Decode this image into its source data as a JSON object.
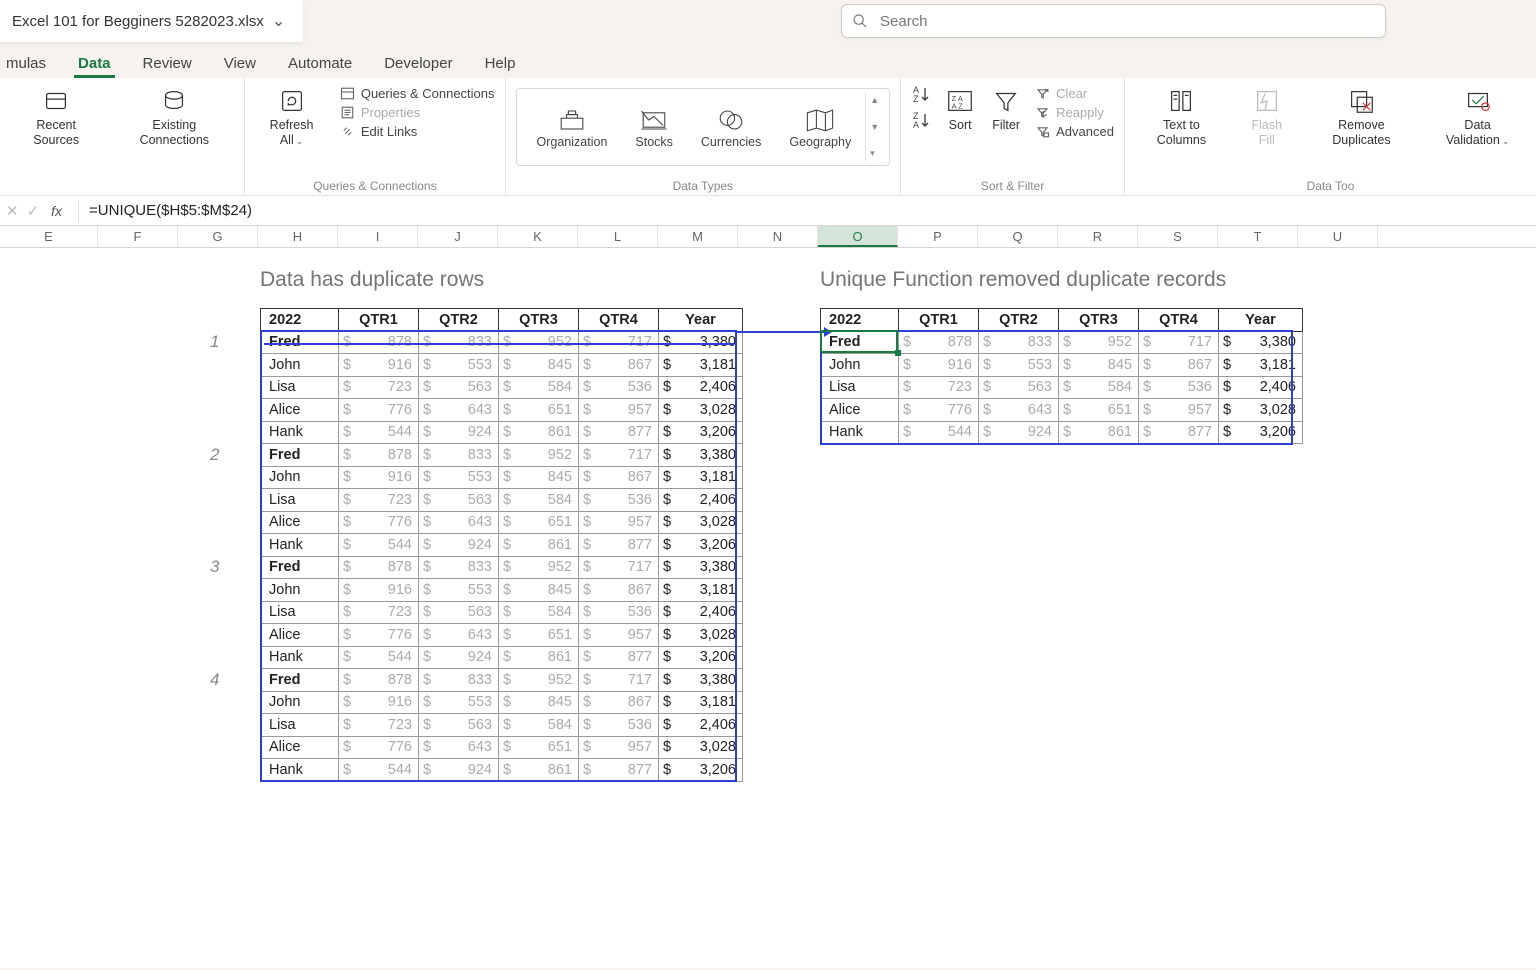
{
  "titlebar": {
    "filename": "Excel 101 for Begginers 5282023.xlsx",
    "search_placeholder": "Search"
  },
  "ribbon_tabs": [
    "mulas",
    "Data",
    "Review",
    "View",
    "Automate",
    "Developer",
    "Help"
  ],
  "active_tab": "Data",
  "ribbon": {
    "recent_sources": "Recent Sources",
    "existing_connections": "Existing Connections",
    "refresh_all": "Refresh All",
    "queries_connections": "Queries & Connections",
    "properties": "Properties",
    "edit_links": "Edit Links",
    "group_qc": "Queries & Connections",
    "organization": "Organization",
    "stocks": "Stocks",
    "currencies": "Currencies",
    "geography": "Geography",
    "group_dt": "Data Types",
    "sort": "Sort",
    "filter": "Filter",
    "clear": "Clear",
    "reapply": "Reapply",
    "advanced": "Advanced",
    "group_sf": "Sort & Filter",
    "text_to_columns": "Text to Columns",
    "flash_fill": "Flash Fill",
    "remove_duplicates": "Remove Duplicates",
    "data_validation": "Data Validation",
    "group_dtools": "Data Too"
  },
  "formula": "=UNIQUE($H$5:$M$24)",
  "columns": [
    "E",
    "F",
    "G",
    "H",
    "I",
    "J",
    "K",
    "L",
    "M",
    "N",
    "O",
    "P",
    "Q",
    "R",
    "S",
    "T",
    "U"
  ],
  "selected_col": "O",
  "titles": {
    "left": "Data has duplicate rows",
    "right": "Unique Function removed duplicate records"
  },
  "headers": [
    "2022",
    "QTR1",
    "QTR2",
    "QTR3",
    "QTR4",
    "Year"
  ],
  "base_rows": [
    {
      "name": "Fred",
      "q": [
        878,
        833,
        952,
        717
      ],
      "year": "3,380",
      "bold": true
    },
    {
      "name": "John",
      "q": [
        916,
        553,
        845,
        867
      ],
      "year": "3,181"
    },
    {
      "name": "Lisa",
      "q": [
        723,
        563,
        584,
        536
      ],
      "year": "2,406"
    },
    {
      "name": "Alice",
      "q": [
        776,
        643,
        651,
        957
      ],
      "year": "3,028"
    },
    {
      "name": "Hank",
      "q": [
        544,
        924,
        861,
        877
      ],
      "year": "3,206"
    }
  ],
  "left_repeats": 4,
  "row_labels": [
    "1",
    "2",
    "3",
    "4"
  ]
}
